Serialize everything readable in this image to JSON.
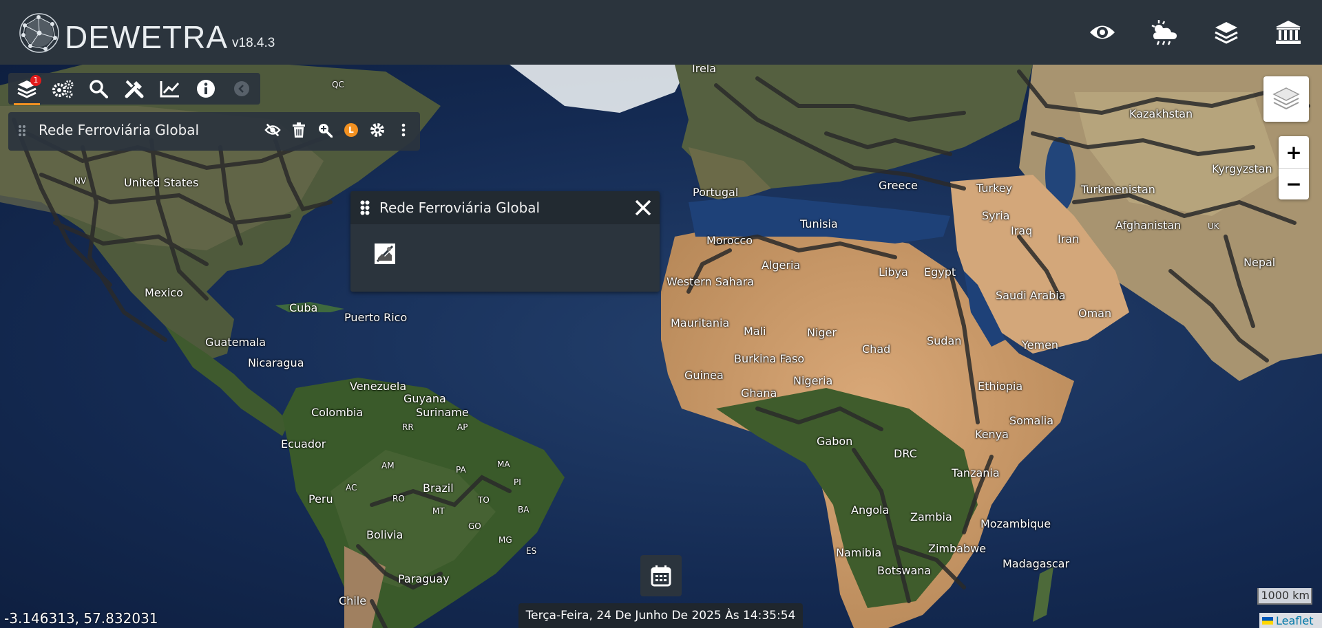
{
  "app": {
    "title": "DEWETRA",
    "version": "v18.4.3"
  },
  "topbar_icons": [
    {
      "name": "eye-icon"
    },
    {
      "name": "weather-icon"
    },
    {
      "name": "layers-icon"
    },
    {
      "name": "institution-icon"
    }
  ],
  "toolbar": {
    "layers_badge": "1",
    "buttons": [
      "layers-icon",
      "settings-icon",
      "search-icon",
      "tools-icon",
      "chart-icon",
      "info-icon",
      "collapse-icon"
    ]
  },
  "layer": {
    "name": "Rede Ferroviária Global",
    "legend_badge": "L"
  },
  "popup": {
    "title": "Rede Ferroviária Global"
  },
  "map": {
    "labels": {
      "irela": "Irela",
      "qc": "QC",
      "nv": "NV",
      "united_states": "United States",
      "mexico": "Mexico",
      "cuba": "Cuba",
      "puerto_rico": "Puerto Rico",
      "guatemala": "Guatemala",
      "nicaragua": "Nicaragua",
      "venezuela": "Venezuela",
      "guyana": "Guyana",
      "suriname": "Suriname",
      "colombia": "Colombia",
      "ecuador": "Ecuador",
      "peru": "Peru",
      "brazil": "Brazil",
      "bolivia": "Bolivia",
      "paraguay": "Paraguay",
      "chile": "Chile",
      "rr": "RR",
      "ap": "AP",
      "am": "AM",
      "pa": "PA",
      "ma": "MA",
      "pi": "PI",
      "ac": "AC",
      "ro": "RO",
      "mt": "MT",
      "to": "TO",
      "ba": "BA",
      "go": "GO",
      "mg": "MG",
      "es": "ES",
      "morocco": "Morocco",
      "western_sahara": "Western Sahara",
      "mauritania": "Mauritania",
      "algeria": "Algeria",
      "libya": "Libya",
      "egypt": "Egypt",
      "mali": "Mali",
      "niger": "Niger",
      "chad": "Chad",
      "sudan": "Sudan",
      "burkina_faso": "Burkina Faso",
      "guinea": "Guinea",
      "ghana": "Ghana",
      "nigeria": "Nigeria",
      "ethiopia": "Ethiopia",
      "somalia": "Somalia",
      "kenya": "Kenya",
      "gabon": "Gabon",
      "drc": "DRC",
      "tanzania": "Tanzania",
      "angola": "Angola",
      "zambia": "Zambia",
      "mozambique": "Mozambique",
      "namibia": "Namibia",
      "zimbabwe": "Zimbabwe",
      "botswana": "Botswana",
      "madagascar": "Madagascar",
      "tunisia": "Tunisia",
      "greece": "Greece",
      "turkey": "Turkey",
      "syria": "Syria",
      "iraq": "Iraq",
      "iran": "Iran",
      "saudi_arabia": "Saudi Arabia",
      "oman": "Oman",
      "yemen": "Yemen",
      "kazakhstan": "Kazakhstan",
      "kyrgyzstan": "Kyrgyzstan",
      "turkmenistan": "Turkmenistan",
      "afghanistan": "Afghanistan",
      "nepal": "Nepal",
      "uk": "UK",
      "portugal": "Portugal"
    }
  },
  "zoom": {
    "in": "+",
    "out": "−"
  },
  "date_text": "Terça-Feira, 24 De Junho De 2025 Às 14:35:54",
  "coordinates": "-3.146313, 57.832031",
  "scale_text": "1000 km",
  "attribution": "Leaflet"
}
